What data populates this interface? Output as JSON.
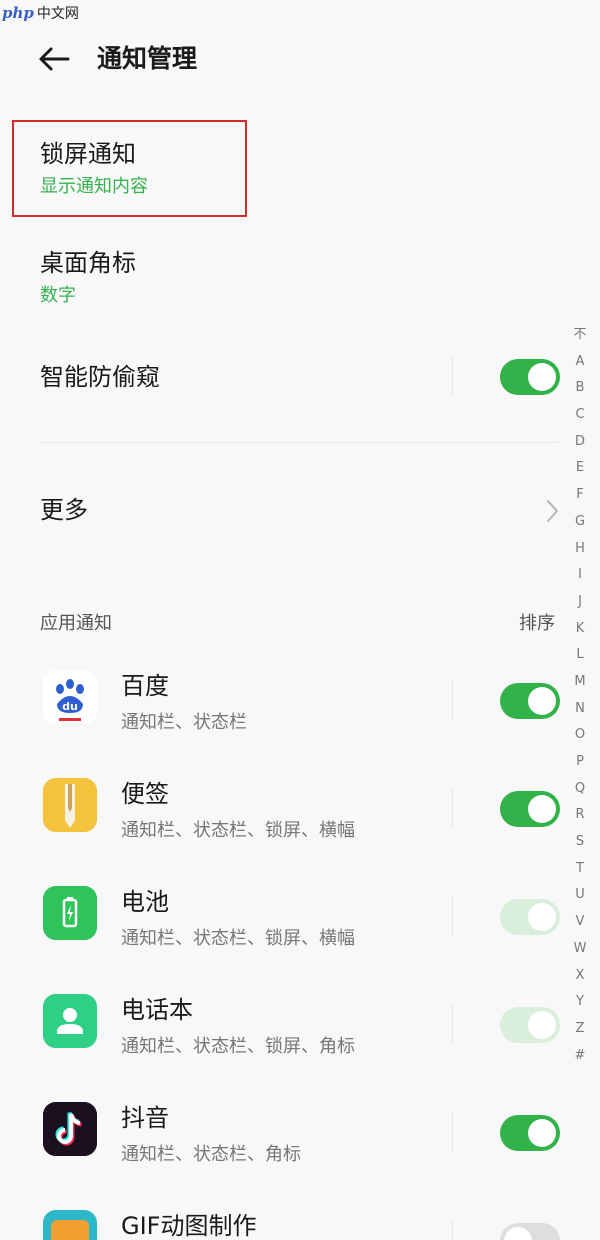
{
  "watermark": {
    "logo": "php",
    "text": "中文网"
  },
  "header": {
    "title": "通知管理"
  },
  "settings": {
    "lockscreen": {
      "title": "锁屏通知",
      "value": "显示通知内容"
    },
    "badge": {
      "title": "桌面角标",
      "value": "数字"
    },
    "privacy": {
      "title": "智能防偷窥",
      "enabled": true
    },
    "more": {
      "title": "更多"
    }
  },
  "apps_section": {
    "label": "应用通知",
    "sort_label": "排序"
  },
  "apps": [
    {
      "name": "百度",
      "channels": "通知栏、状态栏",
      "toggle": "on",
      "icon": "baidu-paw-icon"
    },
    {
      "name": "便签",
      "channels": "通知栏、状态栏、锁屏、横幅",
      "toggle": "on",
      "icon": "notes-pen-icon"
    },
    {
      "name": "电池",
      "channels": "通知栏、状态栏、锁屏、横幅",
      "toggle": "disabled-on",
      "icon": "battery-icon"
    },
    {
      "name": "电话本",
      "channels": "通知栏、状态栏、锁屏、角标",
      "toggle": "disabled-on",
      "icon": "contacts-person-icon"
    },
    {
      "name": "抖音",
      "channels": "通知栏、状态栏、角标",
      "toggle": "on",
      "icon": "douyin-note-icon"
    },
    {
      "name": "GIF动图制作",
      "channels": "",
      "toggle": "off",
      "icon": "gif-maker-icon"
    }
  ],
  "alpha_index": [
    "不",
    "A",
    "B",
    "C",
    "D",
    "E",
    "F",
    "G",
    "H",
    "I",
    "J",
    "K",
    "L",
    "M",
    "N",
    "O",
    "P",
    "Q",
    "R",
    "S",
    "T",
    "U",
    "V",
    "W",
    "X",
    "Y",
    "Z",
    "#"
  ],
  "colors": {
    "accent_green": "#32b34a",
    "subtitle_green": "#36b24f",
    "highlight_red": "#d42b2b",
    "background": "#f8f8f8"
  }
}
